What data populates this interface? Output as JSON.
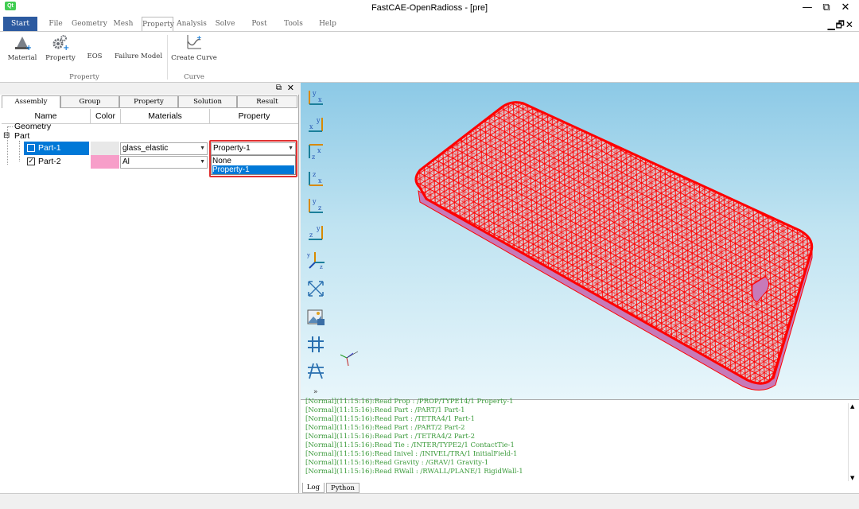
{
  "window": {
    "logo_text": "Qt",
    "title": "FastCAE-OpenRadioss - [pre]",
    "minimize": "—",
    "restore": "⧉",
    "close": "✕",
    "mdi_controls": "▁🗗✕"
  },
  "menu": {
    "tabs": [
      "Start",
      "File",
      "Geometry",
      "Mesh",
      "Property",
      "Analysis",
      "Solve",
      "Post",
      "Tools",
      "Help"
    ],
    "active": "Start",
    "selected": "Property"
  },
  "ribbon": {
    "buttons": [
      "Material",
      "Property",
      "EOS",
      "Failure Model",
      "Create Curve"
    ],
    "groups": [
      "Property",
      "Curve"
    ]
  },
  "left_panel": {
    "tabs": [
      "Assembly",
      "Group",
      "Property",
      "Solution",
      "Result"
    ],
    "columns": [
      "Name",
      "Color",
      "Materials",
      "Property"
    ],
    "tree": {
      "geometry": "Geometry",
      "part": "Part",
      "expander": "⊟",
      "rows": [
        {
          "name": "Part-1",
          "color": "#e8e8e8",
          "material": "glass_elastic",
          "property": "Property-1",
          "checked": false
        },
        {
          "name": "Part-2",
          "color": "#f79ec9",
          "material": "Al",
          "property": "",
          "checked": true
        }
      ]
    },
    "dropdown_options": [
      "None",
      "Property-1"
    ],
    "dropdown_selected": "Property-1"
  },
  "viewport": {
    "toolbar_icons": [
      "view-xy-icon",
      "view-yx-icon",
      "view-xz-icon",
      "view-zx-icon",
      "view-yz-icon",
      "view-zy-icon",
      "view-iso-icon",
      "fit-view-icon",
      "screenshot-icon",
      "grid-icon",
      "mesh-grid-icon"
    ],
    "more_glyph": "»",
    "mesh_color": "#ff0000",
    "body_color": "#d77fc8"
  },
  "console": {
    "lines": [
      "[Normal](11:15:16):Read Prop : /PROP/TYPE14/1 Property-1",
      "[Normal](11:15:16):Read Part : /PART/1 Part-1",
      "[Normal](11:15:16):Read Part : /TETRA4/1 Part-1",
      "[Normal](11:15:16):Read Part : /PART/2 Part-2",
      "[Normal](11:15:16):Read Part : /TETRA4/2 Part-2",
      "[Normal](11:15:16):Read Tie : /INTER/TYPE2/1 ContactTie-1",
      "[Normal](11:15:16):Read Inivel : /INIVEL/TRA/1 InitialField-1",
      "[Normal](11:15:16):Read Gravity : /GRAV/1 Gravity-1",
      "[Normal](11:15:16):Read RWall : /RWALL/PLANE/1 RigidWall-1"
    ],
    "tabs": [
      "Log",
      "Python"
    ]
  }
}
